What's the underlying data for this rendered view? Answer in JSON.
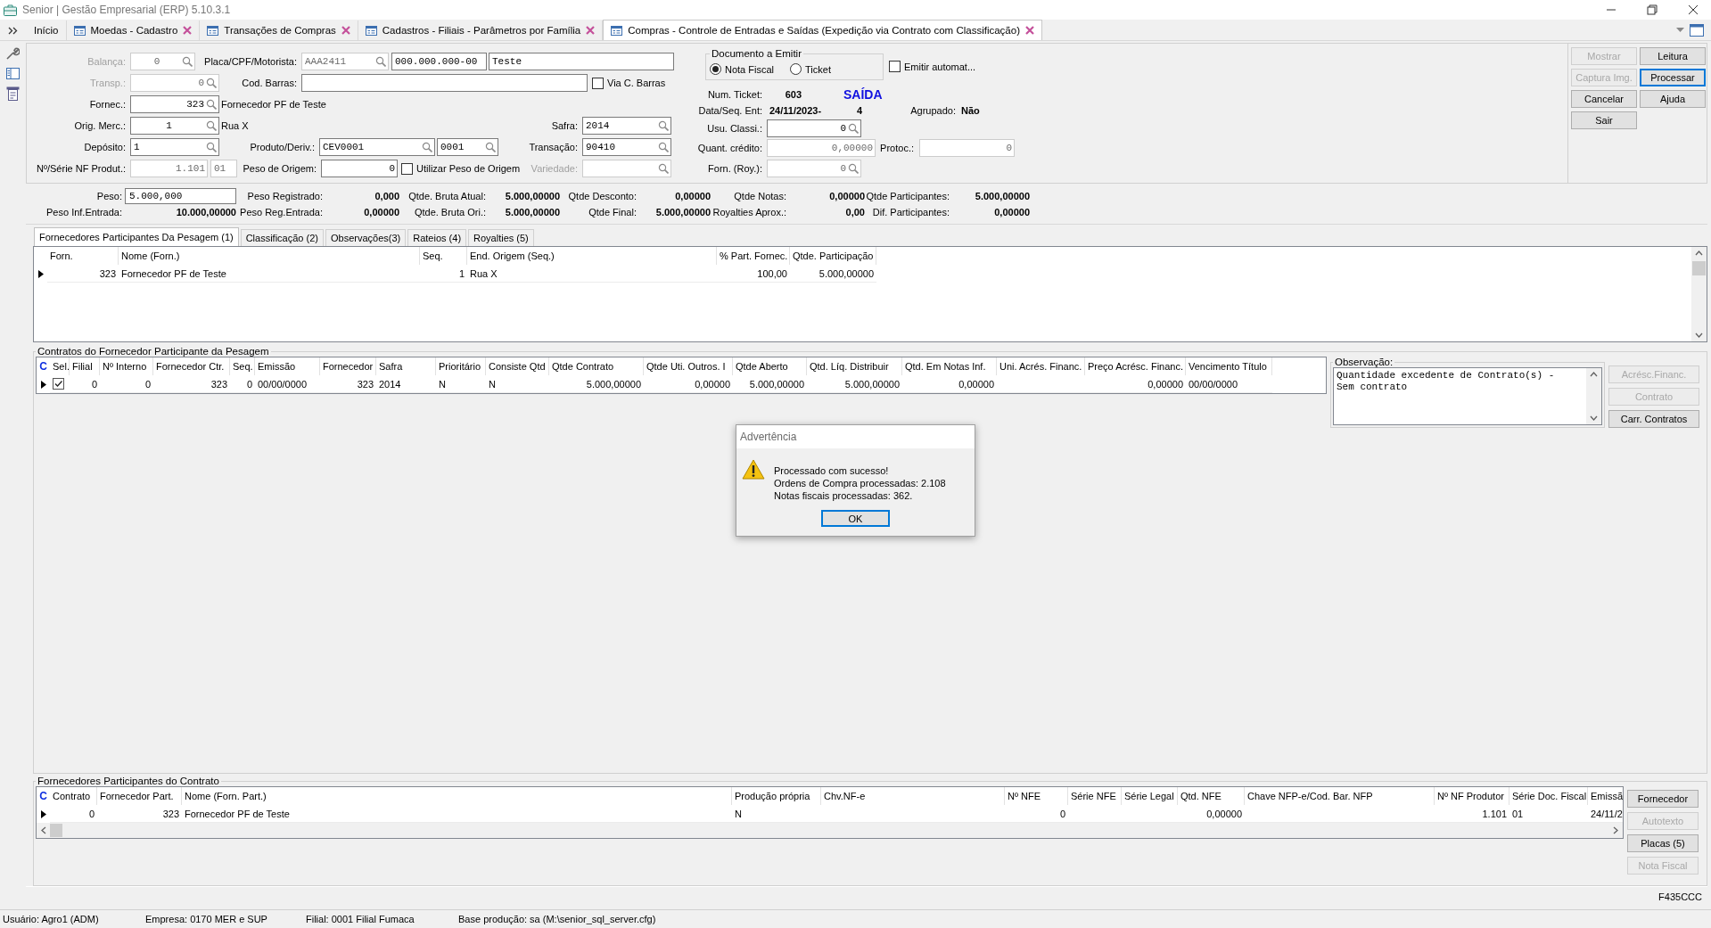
{
  "window": {
    "title": "Senior | Gestão Empresarial (ERP) 5.10.3.1"
  },
  "tabs": [
    {
      "label": "Início",
      "closable": false,
      "selected": false
    },
    {
      "label": "Moedas - Cadastro",
      "closable": true,
      "selected": false
    },
    {
      "label": "Transações de Compras",
      "closable": true,
      "selected": false
    },
    {
      "label": "Cadastros - Filiais - Parâmetros por Família",
      "closable": true,
      "selected": false
    },
    {
      "label": "Compras - Controle de Entradas e Saídas (Expedição via Contrato com Classificação)",
      "closable": true,
      "selected": true
    }
  ],
  "form": {
    "rows": [
      {
        "items": [
          {
            "kind": "label",
            "text": "Balança:",
            "disabled": true
          },
          {
            "kind": "field",
            "value": "0",
            "lookup": true,
            "disabled": true
          },
          {
            "kind": "label",
            "text": "Placa/CPF/Motorista:",
            "disabled": false
          },
          {
            "kind": "field",
            "value": "AAA2411",
            "lookup": true,
            "disabled": true
          },
          {
            "kind": "field",
            "value": "000.000.000-00",
            "lookup": false,
            "disabled": false
          },
          {
            "kind": "field",
            "value": "Teste",
            "lookup": false,
            "disabled": false
          }
        ]
      },
      {
        "items": [
          {
            "kind": "label",
            "text": "Transp.:",
            "disabled": true
          },
          {
            "kind": "field",
            "value": "0",
            "lookup": true,
            "disabled": true
          },
          {
            "kind": "label",
            "text": "Cod. Barras:",
            "disabled": false
          },
          {
            "kind": "field",
            "lookup": false,
            "disabled": false
          },
          {
            "kind": "checkbox",
            "label": "Via C. Barras",
            "checked": false
          }
        ]
      },
      {
        "items": [
          {
            "kind": "label",
            "text": "Fornec.:",
            "disabled": false
          },
          {
            "kind": "field",
            "value": "323",
            "lookup": true,
            "disabled": false
          },
          {
            "kind": "text",
            "text": "Fornecedor PF de Teste"
          }
        ]
      },
      {
        "items": [
          {
            "kind": "label",
            "text": "Orig. Merc.:",
            "disabled": false
          },
          {
            "kind": "field",
            "value": "1",
            "lookup": true,
            "disabled": false
          },
          {
            "kind": "text",
            "text": "Rua X"
          }
        ],
        "side": [
          {
            "kind": "label",
            "text": "Safra:",
            "disabled": false
          },
          {
            "kind": "field",
            "value": "2014",
            "lookup": true,
            "disabled": false
          }
        ]
      },
      {
        "items": [
          {
            "kind": "label",
            "text": "Depósito:",
            "disabled": false
          },
          {
            "kind": "field",
            "value": "1",
            "lookup": true,
            "disabled": false
          },
          {
            "kind": "label",
            "text": "Produto/Deriv.:",
            "disabled": false
          },
          {
            "kind": "field",
            "value": "CEV0001",
            "lookup": true,
            "disabled": false
          },
          {
            "kind": "field",
            "value": "0001",
            "lookup": true,
            "disabled": false
          }
        ],
        "side": [
          {
            "kind": "label",
            "text": "Transação:",
            "disabled": false
          },
          {
            "kind": "field",
            "value": "90410",
            "lookup": true,
            "disabled": false
          }
        ]
      },
      {
        "items": [
          {
            "kind": "label",
            "text": "Nº/Série NF Produt.:",
            "disabled": false
          },
          {
            "kind": "field",
            "value": "1.101",
            "lookup": false,
            "disabled": true
          },
          {
            "kind": "field",
            "value": "01",
            "lookup": false,
            "disabled": true
          },
          {
            "kind": "label",
            "text": "Peso de Origem:",
            "disabled": false
          },
          {
            "kind": "field",
            "value": "0",
            "lookup": false,
            "disabled": false
          },
          {
            "kind": "checkbox",
            "label": "Utilizar Peso de Origem",
            "checked": false
          }
        ],
        "side": [
          {
            "kind": "label",
            "text": "Variedade:",
            "disabled": true
          },
          {
            "kind": "field",
            "lookup": true,
            "disabled": true
          }
        ]
      }
    ]
  },
  "document": {
    "title": "Documento a Emitir",
    "options": [
      {
        "label": "Nota Fiscal",
        "selected": true
      },
      {
        "label": "Ticket",
        "selected": false
      }
    ],
    "auto_emit": {
      "label": "Emitir automat...",
      "checked": false
    },
    "rows": [
      [
        {
          "kind": "label",
          "text": "Num. Ticket:",
          "disabled": false
        },
        {
          "kind": "value",
          "text": "603"
        },
        {
          "kind": "status",
          "text": "SAÍDA"
        }
      ],
      [
        {
          "kind": "label",
          "text": "Data/Seq. Ent:",
          "disabled": false
        },
        {
          "kind": "value",
          "text": "24/11/2023-"
        },
        {
          "kind": "value",
          "text": "4"
        },
        {
          "kind": "label",
          "text": "Agrupado:",
          "disabled": false
        },
        {
          "kind": "value",
          "text": "Não"
        }
      ],
      [
        {
          "kind": "label",
          "text": "Usu. Classi.:",
          "disabled": false
        },
        {
          "kind": "field",
          "value": "0",
          "lookup": true,
          "disabled": false
        }
      ],
      [
        {
          "kind": "label",
          "text": "Quant. crédito:",
          "disabled": false
        },
        {
          "kind": "field",
          "value": "0,00000",
          "lookup": false,
          "disabled": true
        },
        {
          "kind": "label",
          "text": "Protoc.:",
          "disabled": false
        },
        {
          "kind": "field",
          "value": "0",
          "lookup": false,
          "disabled": true
        }
      ],
      [
        {
          "kind": "label",
          "text": "Forn. (Roy.):",
          "disabled": false
        },
        {
          "kind": "field",
          "value": "0",
          "lookup": true,
          "disabled": true
        }
      ]
    ]
  },
  "actions": [
    {
      "label": "Mostrar",
      "disabled": true,
      "focused": false
    },
    {
      "label": "Leitura",
      "disabled": false,
      "focused": false
    },
    {
      "label": "Captura Img.",
      "disabled": true,
      "focused": false
    },
    {
      "label": "Processar",
      "disabled": false,
      "focused": true
    },
    {
      "label": "Cancelar",
      "disabled": false,
      "focused": false
    },
    {
      "label": "Ajuda",
      "disabled": false,
      "focused": false
    },
    {
      "label": "Sair",
      "disabled": false,
      "focused": false
    }
  ],
  "totals": {
    "columns": [
      [
        {
          "kind": "field",
          "label": "Peso:",
          "value": "5.000,000"
        },
        {
          "kind": "value",
          "label": "Peso Inf.Entrada:",
          "value": "10.000,00000"
        }
      ],
      [
        {
          "kind": "value",
          "label": "Peso Registrado:",
          "value": "0,000"
        },
        {
          "kind": "value",
          "label": "Peso Reg.Entrada:",
          "value": "0,00000"
        }
      ],
      [
        {
          "kind": "value",
          "label": "Qtde. Bruta Atual:",
          "value": "5.000,00000"
        },
        {
          "kind": "value",
          "label": "Qtde. Bruta Ori.:",
          "value": "5.000,00000"
        }
      ],
      [
        {
          "kind": "value",
          "label": "Qtde Desconto:",
          "value": "0,00000"
        },
        {
          "kind": "value",
          "label": "Qtde Final:",
          "value": "5.000,00000"
        }
      ],
      [
        {
          "kind": "value",
          "label": "Qtde Notas:",
          "value": "0,00000"
        },
        {
          "kind": "value",
          "label": "Royalties Aprox.:",
          "value": "0,00"
        }
      ],
      [
        {
          "kind": "value",
          "label": "Qtde Participantes:",
          "value": "5.000,00000"
        },
        {
          "kind": "value",
          "label": "Dif. Participantes:",
          "value": "0,00000"
        }
      ]
    ]
  },
  "detail_tabs": [
    {
      "label": "Fornecedores Participantes Da Pesagem (1)",
      "selected": true
    },
    {
      "label": "Classificação (2)",
      "selected": false
    },
    {
      "label": "Observações(3)",
      "selected": false
    },
    {
      "label": "Rateios (4)",
      "selected": false
    },
    {
      "label": "Royalties (5)",
      "selected": false
    }
  ],
  "participants": {
    "columns": [
      "Forn.",
      "Nome (Forn.)",
      "Seq.",
      "End. Origem (Seq.)",
      "% Part. Fornec.",
      "Qtde. Participação"
    ],
    "rows": [
      {
        "cells": [
          "323",
          "Fornecedor PF de Teste",
          "1",
          "Rua X",
          "100,00",
          "5.000,00000"
        ]
      }
    ]
  },
  "contracts": {
    "title": "Contratos do Fornecedor Participante da Pesagem",
    "corner": "C",
    "columns": [
      "Sel.",
      "Filial",
      "Nº Interno",
      "Fornecedor Ctr.",
      "Seq.",
      "Emissão",
      "Fornecedor",
      "Safra",
      "Prioritário",
      "Consiste Qtd",
      "Qtde Contrato",
      "Qtde Uti. Outros. I",
      "Qtde Aberto",
      "Qtd. Líq. Distribuir",
      "Qtd. Em Notas Inf.",
      "Uni. Acrés. Financ.",
      "Preço Acrésc. Financ.",
      "Vencimento Título"
    ],
    "rows": [
      {
        "checked": true,
        "cells": [
          null,
          "0",
          "0",
          "323",
          "0",
          "00/00/0000",
          "323",
          "2014",
          "N",
          "N",
          "5.000,00000",
          "0,00000",
          "5.000,00000",
          "5.000,00000",
          "0,00000",
          null,
          "0,00000",
          "00/00/0000"
        ]
      }
    ]
  },
  "observation": {
    "title": "Observação:",
    "text": "Quantidade excedente de Contrato(s) -\nSem contrato"
  },
  "contract_actions": [
    {
      "label": "Acrésc.Financ.",
      "disabled": true
    },
    {
      "label": "Contrato",
      "disabled": true
    },
    {
      "label": "Carr. Contratos",
      "disabled": false
    }
  ],
  "contract_participants": {
    "title": "Fornecedores Participantes do Contrato",
    "corner": "C",
    "columns": [
      "Contrato",
      "Fornecedor Part.",
      "Nome (Forn. Part.)",
      "Produção própria",
      "Chv.NF-e",
      "Nº NFE",
      "Série NFE",
      "Série Legal",
      "Qtd. NFE",
      "Chave NFP-e/Cod. Bar. NFP",
      "Nº NF Produtor",
      "Série Doc. Fiscal",
      "Emissã"
    ],
    "rows": [
      {
        "cells": [
          "0",
          "323",
          "Fornecedor PF de Teste",
          "N",
          null,
          "0",
          null,
          null,
          "0,00000",
          null,
          "1.101",
          "01",
          "24/11/2"
        ]
      }
    ]
  },
  "participant_actions": [
    {
      "label": "Fornecedor",
      "disabled": false
    },
    {
      "label": "Autotexto",
      "disabled": true
    },
    {
      "label": "Placas (5)",
      "disabled": false
    },
    {
      "label": "Nota Fiscal",
      "disabled": true
    }
  ],
  "form_code": "F435CCC",
  "status_bar": [
    "Usuário: Agro1 (ADM)",
    "Empresa: 0170 MER e SUP",
    "Filial: 0001 Filial Fumaca",
    "Base produção: sa (M:\\senior_sql_server.cfg)"
  ],
  "dialog": {
    "title": "Advertência",
    "lines": [
      "Processado com sucesso!",
      "Ordens de Compra processadas: 2.108",
      "Notas fiscais processadas: 362."
    ],
    "button": "OK"
  }
}
